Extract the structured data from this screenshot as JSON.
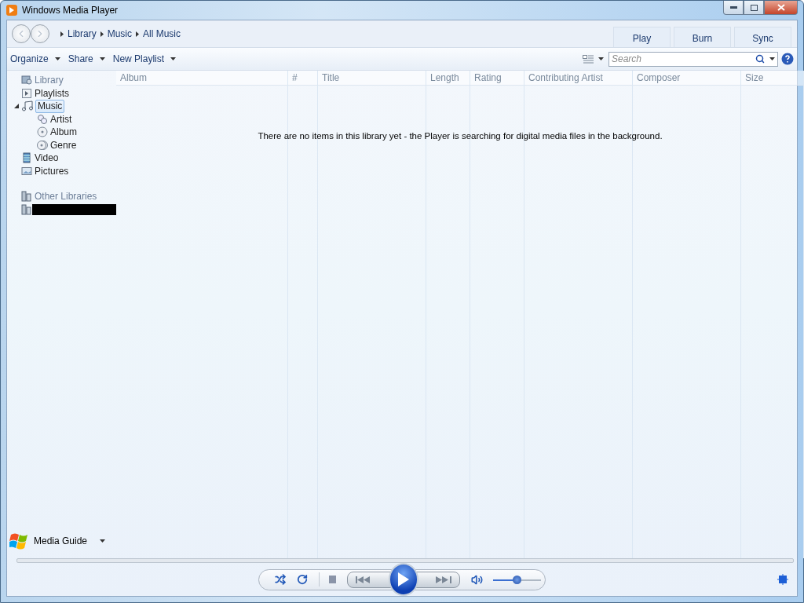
{
  "window": {
    "title": "Windows Media Player"
  },
  "breadcrumb": [
    "Library",
    "Music",
    "All Music"
  ],
  "tabs": [
    "Play",
    "Burn",
    "Sync"
  ],
  "toolbar": {
    "menus": [
      "Organize",
      "Share",
      "New Playlist"
    ]
  },
  "search": {
    "placeholder": "Search"
  },
  "sidebar": {
    "items": [
      {
        "label": "Library",
        "kind": "heading",
        "selected": false
      },
      {
        "label": "Playlists",
        "kind": "playlists",
        "selected": false
      },
      {
        "label": "Music",
        "kind": "music",
        "selected": true,
        "expanded": true,
        "children": [
          {
            "label": "Artist",
            "kind": "artist",
            "selected": false
          },
          {
            "label": "Album",
            "kind": "album",
            "selected": false
          },
          {
            "label": "Genre",
            "kind": "genre",
            "selected": false
          }
        ]
      },
      {
        "label": "Video",
        "kind": "video",
        "selected": false
      },
      {
        "label": "Pictures",
        "kind": "pictures",
        "selected": false
      },
      {
        "label": "Other Libraries",
        "kind": "other",
        "selected": false
      },
      {
        "kind": "redacted",
        "selected": false
      }
    ]
  },
  "columns": [
    "Album",
    "#",
    "Title",
    "Length",
    "Rating",
    "Contributing Artist",
    "Composer",
    "Size"
  ],
  "empty_message": "There are no items in this library yet - the Player is searching for digital media files in the background.",
  "media_guide": {
    "label": "Media Guide"
  },
  "player": {
    "volume": {
      "level": 0.49
    }
  }
}
